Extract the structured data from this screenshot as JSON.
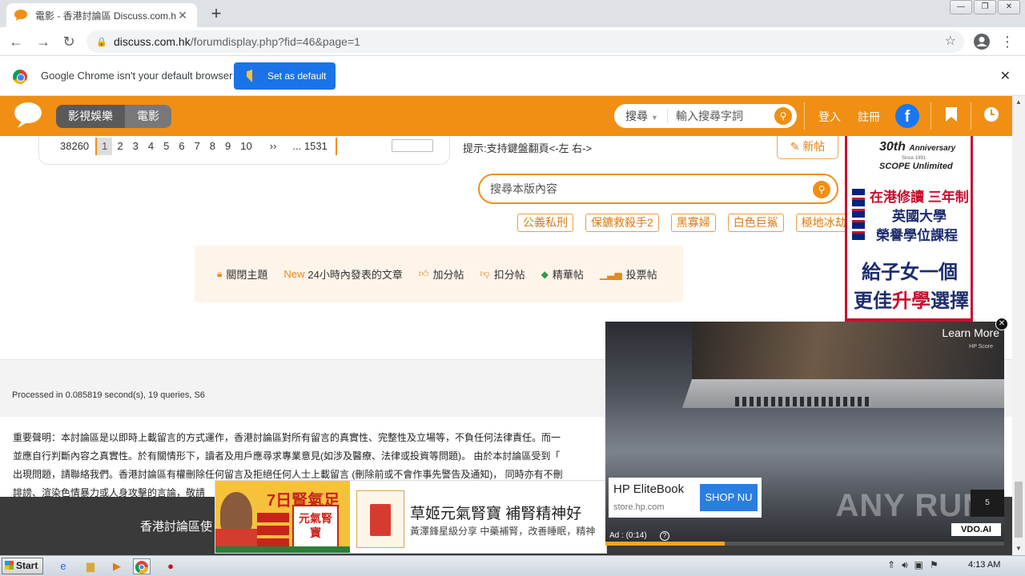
{
  "browser": {
    "tab_title": "電影 - 香港討論區 Discuss.com.hk -",
    "tab_close": "✕",
    "new_tab": "+",
    "url_host": "discuss.com.hk",
    "url_path": "/forumdisplay.php?fid=46&page=1",
    "infobar_message": "Google Chrome isn't your default browser",
    "set_default_label": "Set as default",
    "infobar_close": "✕"
  },
  "site_header": {
    "tabs": [
      "影視娛樂",
      "電影"
    ],
    "search_scope": "搜尋",
    "search_placeholder": "輸入搜尋字詞",
    "login": "登入",
    "register": "註冊",
    "fb": "f"
  },
  "pagination": {
    "total": "38260",
    "pages": [
      "1",
      "2",
      "3",
      "4",
      "5",
      "6",
      "7",
      "8",
      "9",
      "10"
    ],
    "next": "››",
    "last": "... 1531"
  },
  "hint": "提示:支持鍵盤翻頁<-左 右->",
  "new_post": "新帖",
  "board_search_placeholder": "搜尋本版內容",
  "tags": [
    "公義私刑",
    "保鑣救殺手2",
    "黑寡婦",
    "白色巨鯊",
    "極地冰劫"
  ],
  "legend": {
    "closed": "關閉主題",
    "new_badge": "New",
    "new_24h": "24小時內發表的文章",
    "plus": "加分帖",
    "minus": "扣分帖",
    "digest": "精華帖",
    "poll": "投票帖"
  },
  "side_ad": {
    "anniv": "30th",
    "anniv_word": "Anniversary",
    "since": "Since 1991",
    "scope": "SCOPE Unlimited",
    "line1": "在港修讀 三年制",
    "line2": "英國大學",
    "line3": "榮譽學位課程",
    "line4": "給子女一個",
    "line5a": "更佳",
    "line5b": "升學",
    "line5c": "選擇"
  },
  "processed": "Processed in 0.085819 second(s), 19 queries, S6",
  "disclaimer": [
    "重要聲明：本討論區是以即時上載留言的方式運作，香港討論區對所有留言的真實性、完整性及立場等，不負任何法律責任。而一",
    "並應自行判斷內容之真實性。於有關情形下，讀者及用戶應尋求專業意見(如涉及醫療、法律或投資等問題)。 由於本討論區受到「",
    "出現問題，請聯絡我們。香港討論區有權刪除任何留言及拒絕任何人士上載留言 (刪除前或不會作事先警告及通知)， 同時亦有不刪",
    "誹謗、渲染色情暴力或人身攻擊的言論，敬請"
  ],
  "dark_footer": "香港討論區使",
  "bottom_ad": {
    "promo": "7日腎氣足",
    "product_box": "元氣腎寶",
    "headline": "草姬元氣腎寶 補腎精神好",
    "sub": "黃澤鋒星級分享 中藥補腎，改善睡眠，精神"
  },
  "video_ad": {
    "learn_more": "Learn More",
    "hp_mark": "HP Score",
    "product": "HP EliteBook",
    "domain": "store.hp.com",
    "shop": "SHOP NU",
    "ad_time": "Ad : (0:14)",
    "skip": "5",
    "vdo": "VDO.AI",
    "watermark": "ANY RUN",
    "progress": 0.3
  },
  "taskbar": {
    "start": "Start",
    "clock": "4:13 AM"
  }
}
